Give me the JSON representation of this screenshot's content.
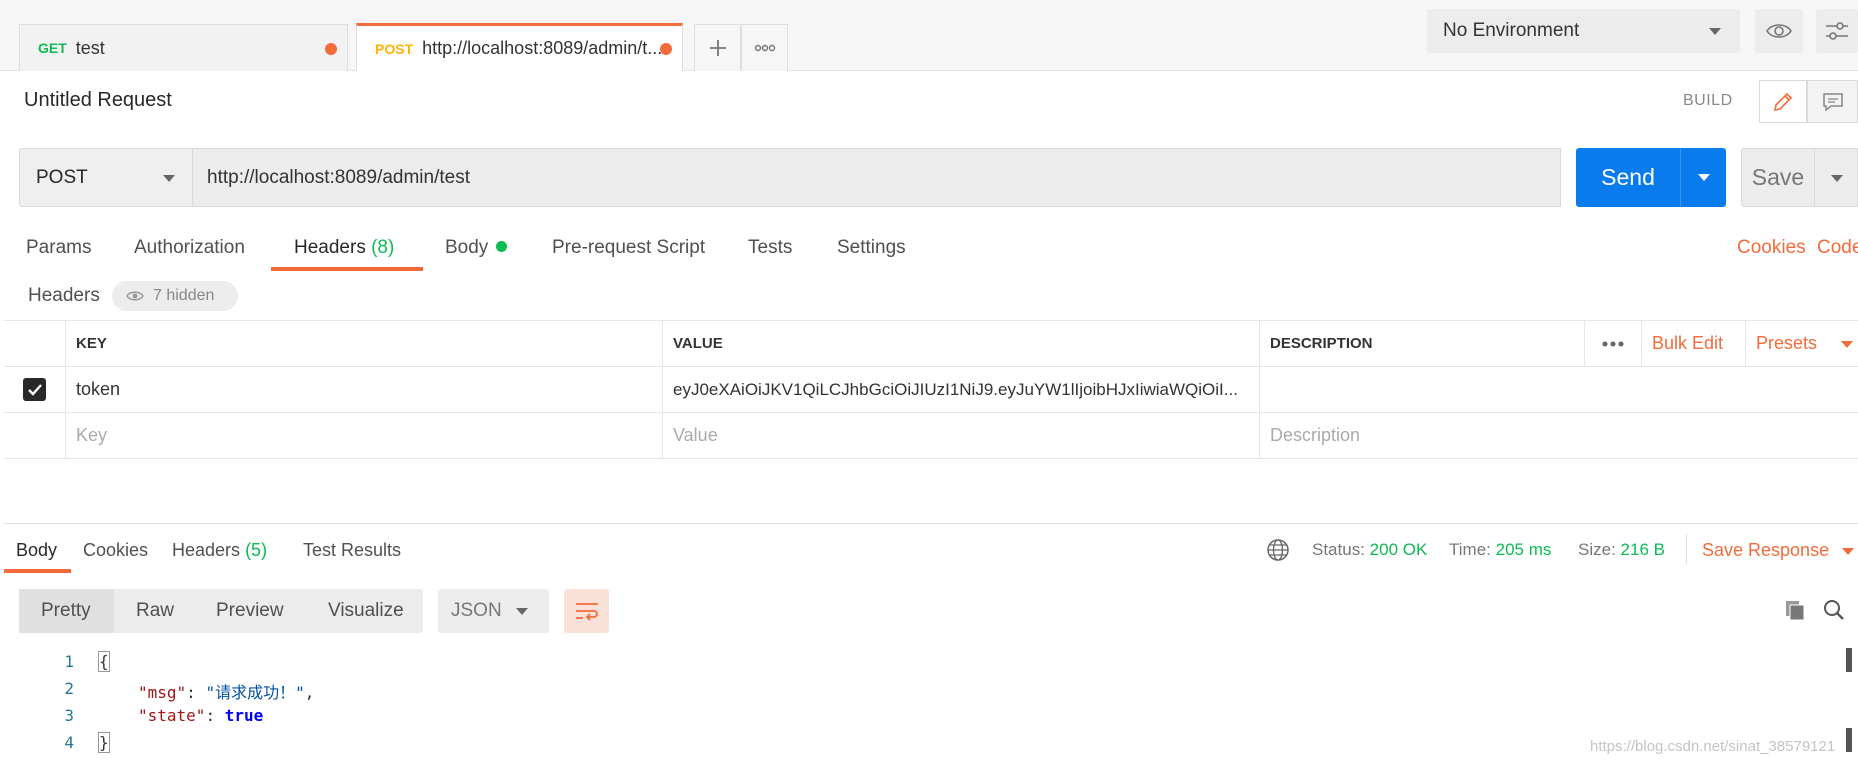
{
  "tabs": [
    {
      "method": "GET",
      "name": "test",
      "unsaved": true
    },
    {
      "method": "POST",
      "name": "http://localhost:8089/admin/t...",
      "unsaved": true
    }
  ],
  "environment": {
    "selected": "No Environment"
  },
  "request": {
    "title": "Untitled Request",
    "mode_label": "BUILD",
    "method": "POST",
    "url": "http://localhost:8089/admin/test",
    "send_label": "Send",
    "save_label": "Save"
  },
  "request_tabs": {
    "params": "Params",
    "authorization": "Authorization",
    "headers": "Headers",
    "headers_count": "(8)",
    "body": "Body",
    "pre_request": "Pre-request Script",
    "tests": "Tests",
    "settings": "Settings",
    "cookies": "Cookies",
    "code": "Code"
  },
  "headers_section": {
    "label": "Headers",
    "hidden": "7 hidden",
    "columns": {
      "key": "KEY",
      "value": "VALUE",
      "description": "DESCRIPTION"
    },
    "bulk_edit": "Bulk Edit",
    "presets": "Presets",
    "rows": [
      {
        "checked": true,
        "key": "token",
        "value": "eyJ0eXAiOiJKV1QiLCJhbGciOiJIUzI1NiJ9.eyJuYW1lIjoibHJxIiwiaWQiOiI...",
        "description": ""
      }
    ],
    "placeholders": {
      "key": "Key",
      "value": "Value",
      "description": "Description"
    }
  },
  "response": {
    "tabs": {
      "body": "Body",
      "cookies": "Cookies",
      "headers": "Headers",
      "headers_count": "(5)",
      "test_results": "Test Results"
    },
    "status_label": "Status:",
    "status": "200 OK",
    "time_label": "Time:",
    "time": "205 ms",
    "size_label": "Size:",
    "size": "216 B",
    "save_response": "Save Response",
    "view_modes": [
      "Pretty",
      "Raw",
      "Preview",
      "Visualize"
    ],
    "active_view": "Pretty",
    "format": "JSON",
    "code_lines": [
      "{",
      "\"msg\": \"请求成功！\",",
      "\"state\": true",
      "}"
    ],
    "line_numbers": [
      "1",
      "2",
      "3",
      "4"
    ]
  },
  "watermark": "https://blog.csdn.net/sinat_38579121",
  "colors": {
    "accent": "#f26b3a",
    "send_blue": "#097bed",
    "success_green": "#0cbb52",
    "post_yellow": "#ffb400"
  }
}
